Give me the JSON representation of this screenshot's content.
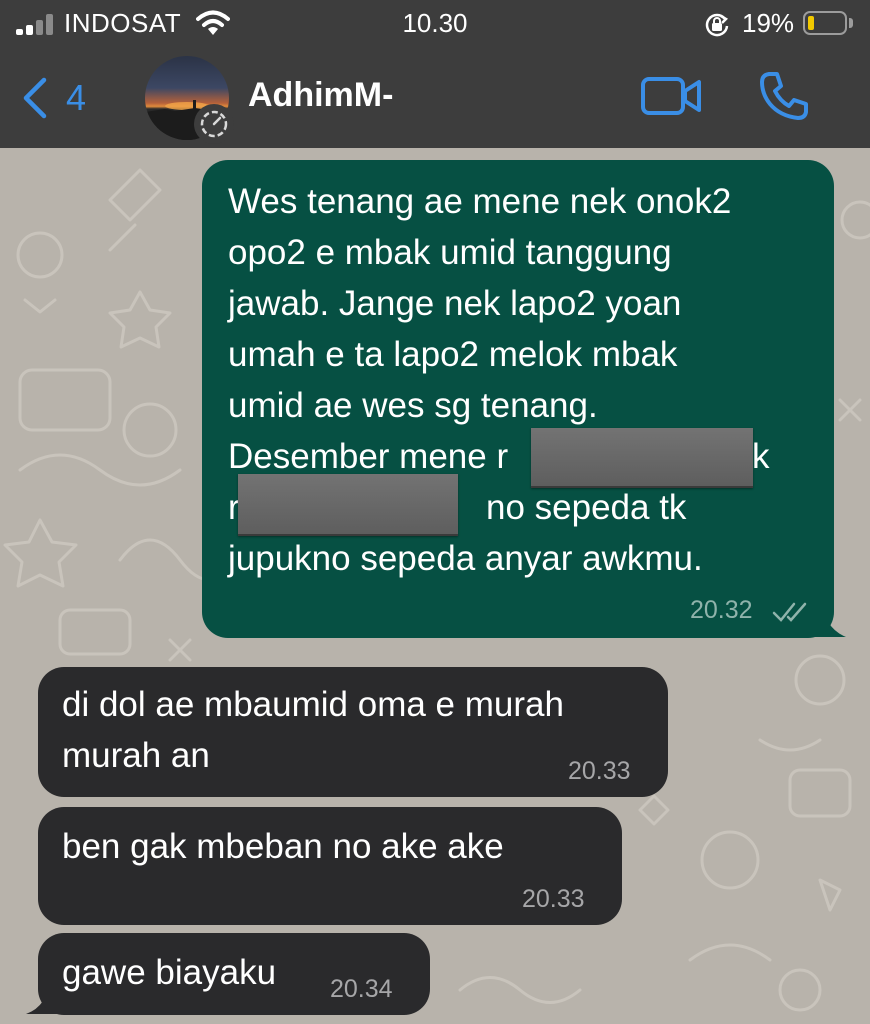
{
  "status_bar": {
    "carrier": "INDOSAT",
    "time": "10.30",
    "battery_percent": "19%",
    "battery_level": 0.19,
    "battery_color": "#f2c900",
    "icons": [
      "signal-icon",
      "wifi-icon",
      "rotation-lock-icon",
      "battery-icon"
    ]
  },
  "header": {
    "back_count": "4",
    "contact_name": "AdhimM-",
    "accent_color": "#3a8ee6",
    "icons": [
      "chevron-left-icon",
      "status-icon",
      "video-call-icon",
      "phone-icon"
    ]
  },
  "messages": [
    {
      "direction": "outgoing",
      "lines": [
        "Wes tenang ae mene nek onok2",
        "opo2 e mbak umid tanggung",
        "jawab. Jange nek lapo2 yoan",
        "umah e ta lapo2 melok mbak",
        "umid ae wes sg tenang.",
        "Desember mene r",
        "r",
        "jupukno sepeda anyar awkmu."
      ],
      "line6_tail": "k",
      "line7_tail": "no sepeda tk",
      "redacted_areas": 2,
      "time": "20.32",
      "status": "read",
      "color": "#065043"
    },
    {
      "direction": "incoming",
      "lines": [
        "di dol ae mbaumid oma e murah",
        "murah an"
      ],
      "time": "20.33"
    },
    {
      "direction": "incoming",
      "lines": [
        "ben gak mbeban no ake ake"
      ],
      "time": "20.33"
    },
    {
      "direction": "incoming",
      "lines": [
        "gawe biayaku"
      ],
      "time": "20.34",
      "color": "#2a2a2c"
    }
  ]
}
